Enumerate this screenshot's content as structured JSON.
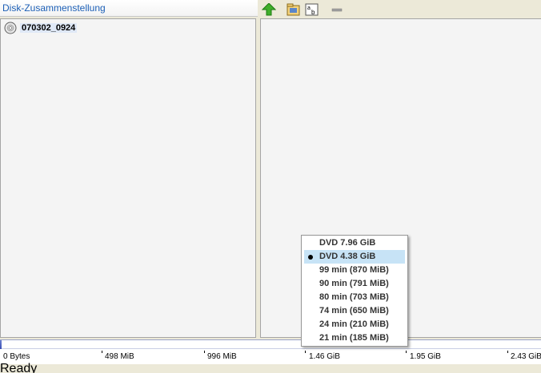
{
  "panel": {
    "title": "Disk-Zusammenstellung"
  },
  "tree": {
    "root_label": "070302_0924"
  },
  "toolbar": {
    "buttons": [
      "up-arrow-icon",
      "folder-icon",
      "rename-icon",
      "minus-icon"
    ]
  },
  "capacity": {
    "used_fraction": 0.003,
    "scale_labels": [
      "0 Bytes",
      "498 MiB",
      "996 MiB",
      "1.46 GiB",
      "1.95 GiB",
      "2.43 GiB"
    ]
  },
  "menu": {
    "items": [
      {
        "label": "DVD 7.96 GiB",
        "selected": false
      },
      {
        "label": "DVD 4.38 GiB",
        "selected": true
      },
      {
        "label": "99 min (870 MiB)",
        "selected": false
      },
      {
        "label": "90 min (791 MiB)",
        "selected": false
      },
      {
        "label": "80 min (703 MiB)",
        "selected": false
      },
      {
        "label": "74 min (650 MiB)",
        "selected": false
      },
      {
        "label": "24 min (210 MiB)",
        "selected": false
      },
      {
        "label": "21 min (185 MiB)",
        "selected": false
      }
    ]
  },
  "status": {
    "text": "Ready"
  },
  "colors": {
    "title": "#1c5fb6",
    "capacity_fill": "#3a4fb5",
    "menu_selected": "#c7e3f6"
  }
}
